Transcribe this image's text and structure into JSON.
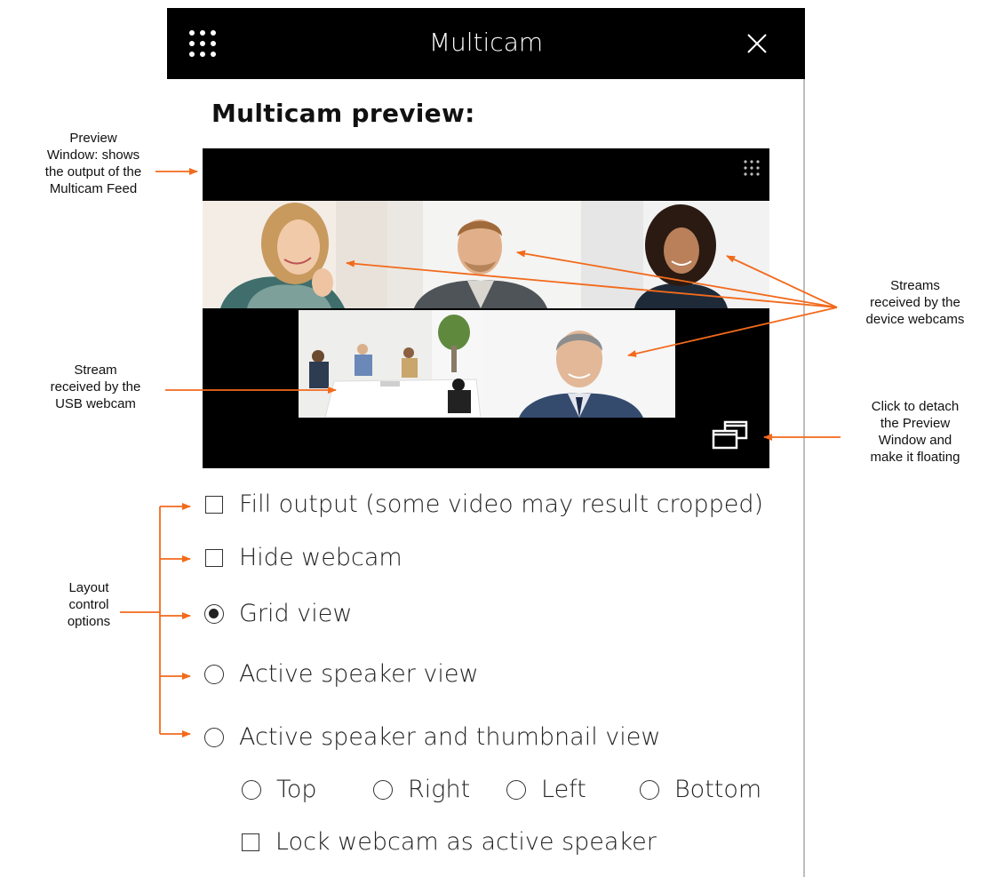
{
  "window": {
    "title": "Multicam",
    "menu_icon": "grid-menu-icon",
    "close_icon": "close-icon"
  },
  "heading": "Multicam preview:",
  "preview": {
    "tiles": [
      {
        "name": "webcam-stream-woman-blonde"
      },
      {
        "name": "webcam-stream-man-smiling"
      },
      {
        "name": "webcam-stream-woman-curly"
      },
      {
        "name": "usb-webcam-stream-meeting-room"
      },
      {
        "name": "webcam-stream-man-suit"
      }
    ]
  },
  "options": {
    "fill_output": {
      "label": "Fill output (some video may result cropped)",
      "checked": false
    },
    "hide_webcam": {
      "label": "Hide webcam",
      "checked": false
    },
    "grid_view": {
      "label": "Grid view",
      "selected": true
    },
    "active_speaker_view": {
      "label": "Active speaker view",
      "selected": false
    },
    "active_speaker_thumbnail_view": {
      "label": "Active speaker and thumbnail view",
      "selected": false
    },
    "thumbnail_positions": [
      {
        "label": "Top",
        "selected": false
      },
      {
        "label": "Right",
        "selected": false
      },
      {
        "label": "Left",
        "selected": false
      },
      {
        "label": "Bottom",
        "selected": false
      }
    ],
    "lock_webcam": {
      "label": "Lock webcam as active speaker",
      "checked": false
    }
  },
  "annotations": {
    "preview_window": [
      "Preview",
      "Window: shows",
      "the output of the",
      "Multicam Feed"
    ],
    "usb_stream": [
      "Stream",
      "received by the",
      "USB webcam"
    ],
    "layout_controls": [
      "Layout",
      "control",
      "options"
    ],
    "device_streams": [
      "Streams",
      "received by the",
      "device webcams"
    ],
    "detach": [
      "Click to detach",
      "the Preview",
      "Window and",
      "make it floating"
    ]
  },
  "colors": {
    "annotation_arrow": "#f26a1b",
    "titlebar": "#000000",
    "preview_bg": "#000000"
  }
}
